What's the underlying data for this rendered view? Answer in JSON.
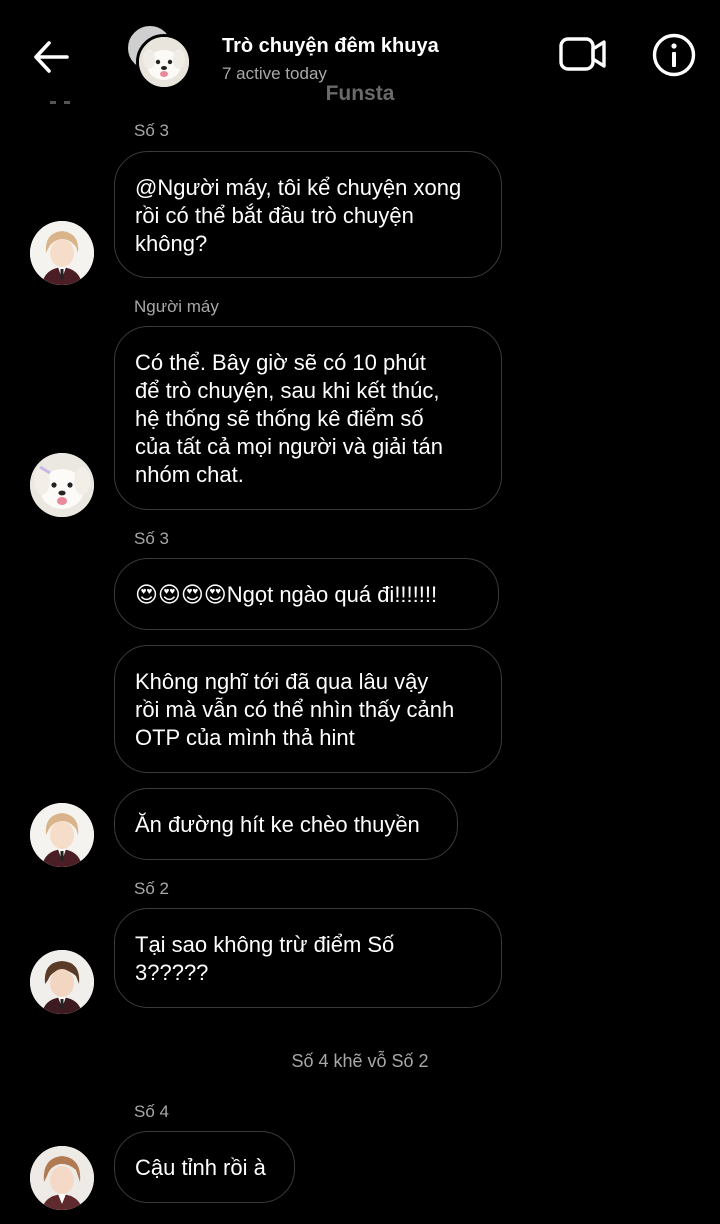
{
  "header": {
    "title": "Trò chuyện đêm khuya",
    "subtitle": "7 active today",
    "back_icon": "arrow-left-icon",
    "video_icon": "video-camera-icon",
    "info_icon": "info-icon"
  },
  "watermark": "Funsta",
  "messages": [
    {
      "sender": "Số 3",
      "text": "@Người máy, tôi kể chuyện xong\nrồi có thể bắt đầu trò chuyện\nkhông?"
    },
    {
      "sender": "Người máy",
      "text": "Có thể. Bây giờ sẽ có 10 phút\nđể trò chuyện, sau khi kết thúc,\nhệ thống sẽ thống kê điểm số\ncủa tất cả mọi người và giải tán\nnhóm chat."
    },
    {
      "sender": "Số 3",
      "text": "😍😍😍😍Ngọt ngào quá đi!!!!!!!"
    },
    {
      "text": "Không nghĩ tới đã qua lâu vậy\nrồi mà vẫn có thể nhìn thấy cảnh\nOTP của mình thả hint"
    },
    {
      "text": "Ăn đường hít ke chèo thuyền"
    },
    {
      "sender": "Số 2",
      "text": "Tại sao không trừ điểm Số\n3?????"
    },
    {
      "sender": "Số 4",
      "text": "Cậu tỉnh rồi à"
    }
  ],
  "system_notice": "Số 4 khẽ vỗ Số 2",
  "colors": {
    "background": "#000000",
    "bubble_border": "#3a3a3a",
    "secondary_text": "#a8a8a8"
  }
}
